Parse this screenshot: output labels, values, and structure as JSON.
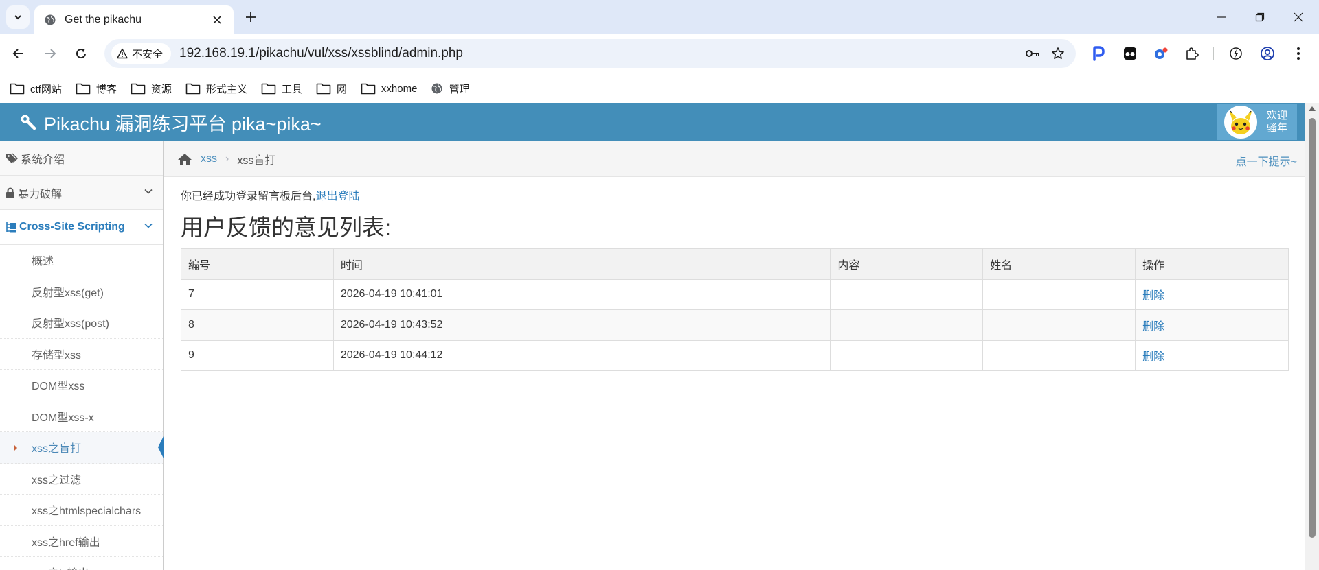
{
  "browser": {
    "tab_title": "Get the pikachu",
    "security_label": "不安全",
    "url": "192.168.19.1/pikachu/vul/xss/xssblind/admin.php",
    "bookmarks": [
      {
        "icon": "folder-icon",
        "label": "ctf网站"
      },
      {
        "icon": "folder-icon",
        "label": "博客"
      },
      {
        "icon": "folder-icon",
        "label": "资源"
      },
      {
        "icon": "folder-icon",
        "label": "形式主义"
      },
      {
        "icon": "folder-icon",
        "label": "工具"
      },
      {
        "icon": "folder-icon",
        "label": "网"
      },
      {
        "icon": "folder-icon",
        "label": "xxhome"
      },
      {
        "icon": "globe-icon",
        "label": "管理"
      }
    ]
  },
  "header": {
    "brand": "Pikachu 漏洞练习平台 pika~pika~",
    "welcome_line1": "欢迎",
    "welcome_line2": "骚年"
  },
  "sidebar": {
    "items": [
      {
        "label": "系统介绍",
        "icon": "tags-icon"
      },
      {
        "label": "暴力破解",
        "icon": "lock-icon"
      },
      {
        "label": "Cross-Site Scripting",
        "icon": "sitemap-icon"
      }
    ],
    "sub_items": [
      "概述",
      "反射型xss(get)",
      "反射型xss(post)",
      "存储型xss",
      "DOM型xss",
      "DOM型xss-x",
      "xss之盲打",
      "xss之过滤",
      "xss之htmlspecialchars",
      "xss之href输出",
      "xss之js输出"
    ],
    "active_sub_index": 6
  },
  "breadcrumb": {
    "parent": "xss",
    "current": "xss盲打",
    "hint": "点一下提示~"
  },
  "content": {
    "login_msg": "你已经成功登录留言板后台,",
    "logout_link": "退出登陆",
    "list_title": "用户反馈的意见列表:",
    "table": {
      "headers": [
        "编号",
        "时间",
        "内容",
        "姓名",
        "操作"
      ],
      "rows": [
        {
          "id": "7",
          "time": "2026-04-19 10:41:01",
          "content": "",
          "name": "",
          "action": "删除"
        },
        {
          "id": "8",
          "time": "2026-04-19 10:43:52",
          "content": "",
          "name": "",
          "action": "删除"
        },
        {
          "id": "9",
          "time": "2026-04-19 10:44:12",
          "content": "",
          "name": "",
          "action": "删除"
        }
      ]
    }
  },
  "colors": {
    "navbar": "#438eb9",
    "user_box": "#62a8d1",
    "link": "#2b7dbc"
  }
}
